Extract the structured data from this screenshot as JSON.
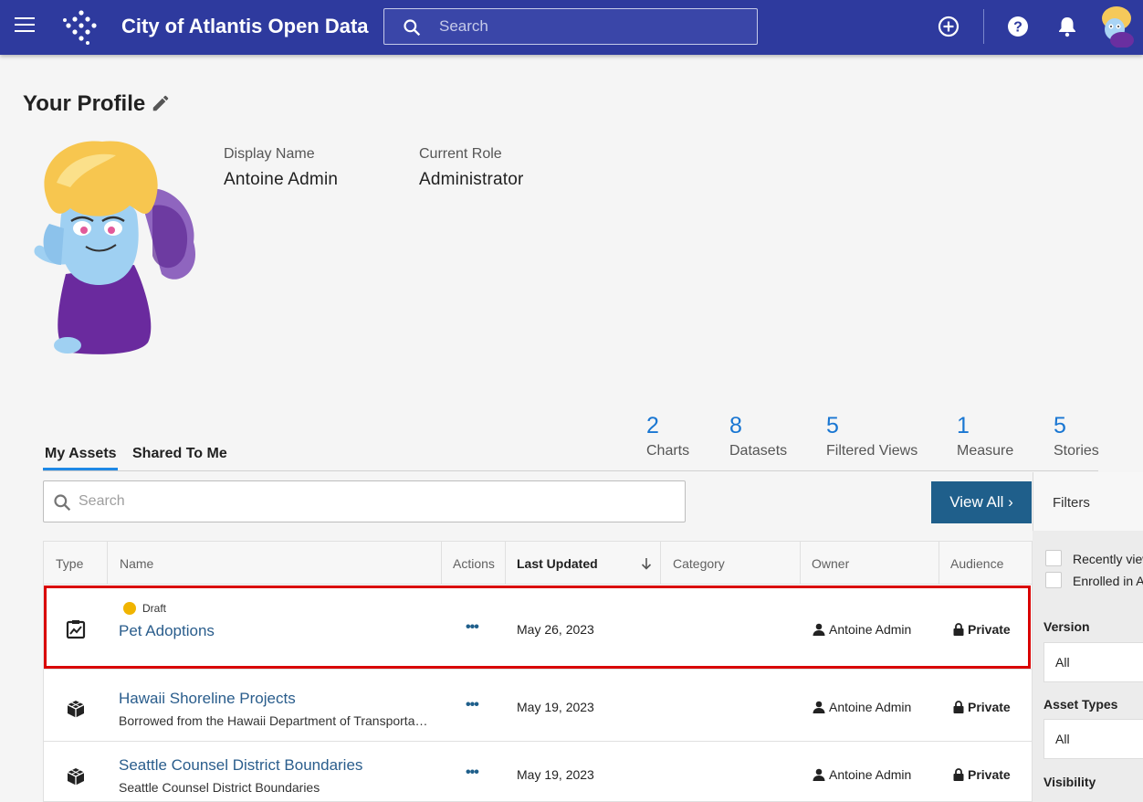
{
  "header": {
    "title": "City of Atlantis Open Data",
    "search_placeholder": "Search",
    "icons": [
      "menu-icon",
      "logo",
      "search-icon",
      "add-icon",
      "help-icon",
      "bell-icon",
      "avatar"
    ]
  },
  "profile": {
    "title": "Your Profile",
    "display_name_label": "Display Name",
    "display_name": "Antoine Admin",
    "role_label": "Current Role",
    "role": "Administrator"
  },
  "tabs": [
    {
      "label": "My Assets",
      "active": true
    },
    {
      "label": "Shared To Me",
      "active": false
    }
  ],
  "stats": [
    {
      "count": "2",
      "label": "Charts"
    },
    {
      "count": "8",
      "label": "Datasets"
    },
    {
      "count": "5",
      "label": "Filtered Views"
    },
    {
      "count": "1",
      "label": "Measure"
    },
    {
      "count": "5",
      "label": "Stories"
    }
  ],
  "assets": {
    "search_placeholder": "Search",
    "view_all_label": "View All",
    "columns": [
      "Type",
      "Name",
      "Actions",
      "Last Updated",
      "Category",
      "Owner",
      "Audience"
    ],
    "rows": [
      {
        "type_icon": "chart-icon",
        "status": "Draft",
        "name": "Pet Adoptions",
        "description": "",
        "actions": "•••",
        "last_updated": "May 26, 2023",
        "category": "",
        "owner": "Antoine Admin",
        "audience": "Private"
      },
      {
        "type_icon": "dataset-icon",
        "status": "",
        "name": "Hawaii Shoreline Projects",
        "description": "Borrowed from the Hawaii Department of Transportation",
        "actions": "•••",
        "last_updated": "May 19, 2023",
        "category": "",
        "owner": "Antoine Admin",
        "audience": "Private"
      },
      {
        "type_icon": "dataset-icon",
        "status": "",
        "name": "Seattle Counsel District Boundaries",
        "description": "Seattle Counsel District Boundaries",
        "actions": "•••",
        "last_updated": "May 19, 2023",
        "category": "",
        "owner": "Antoine Admin",
        "audience": "Private"
      }
    ]
  },
  "filters": {
    "title": "Filters",
    "checkboxes": [
      "Recently viewed",
      "Enrolled in Approvals"
    ],
    "version_label": "Version",
    "version_value": "All",
    "asset_types_label": "Asset Types",
    "asset_types_value": "All",
    "visibility_label": "Visibility"
  },
  "colors": {
    "header_bg": "#2e3a9e",
    "link": "#2a5d8c",
    "stat_number": "#1976d2",
    "view_all_bg": "#1f5f8b",
    "highlight": "#d90000",
    "draft_badge": "#f0b400"
  }
}
